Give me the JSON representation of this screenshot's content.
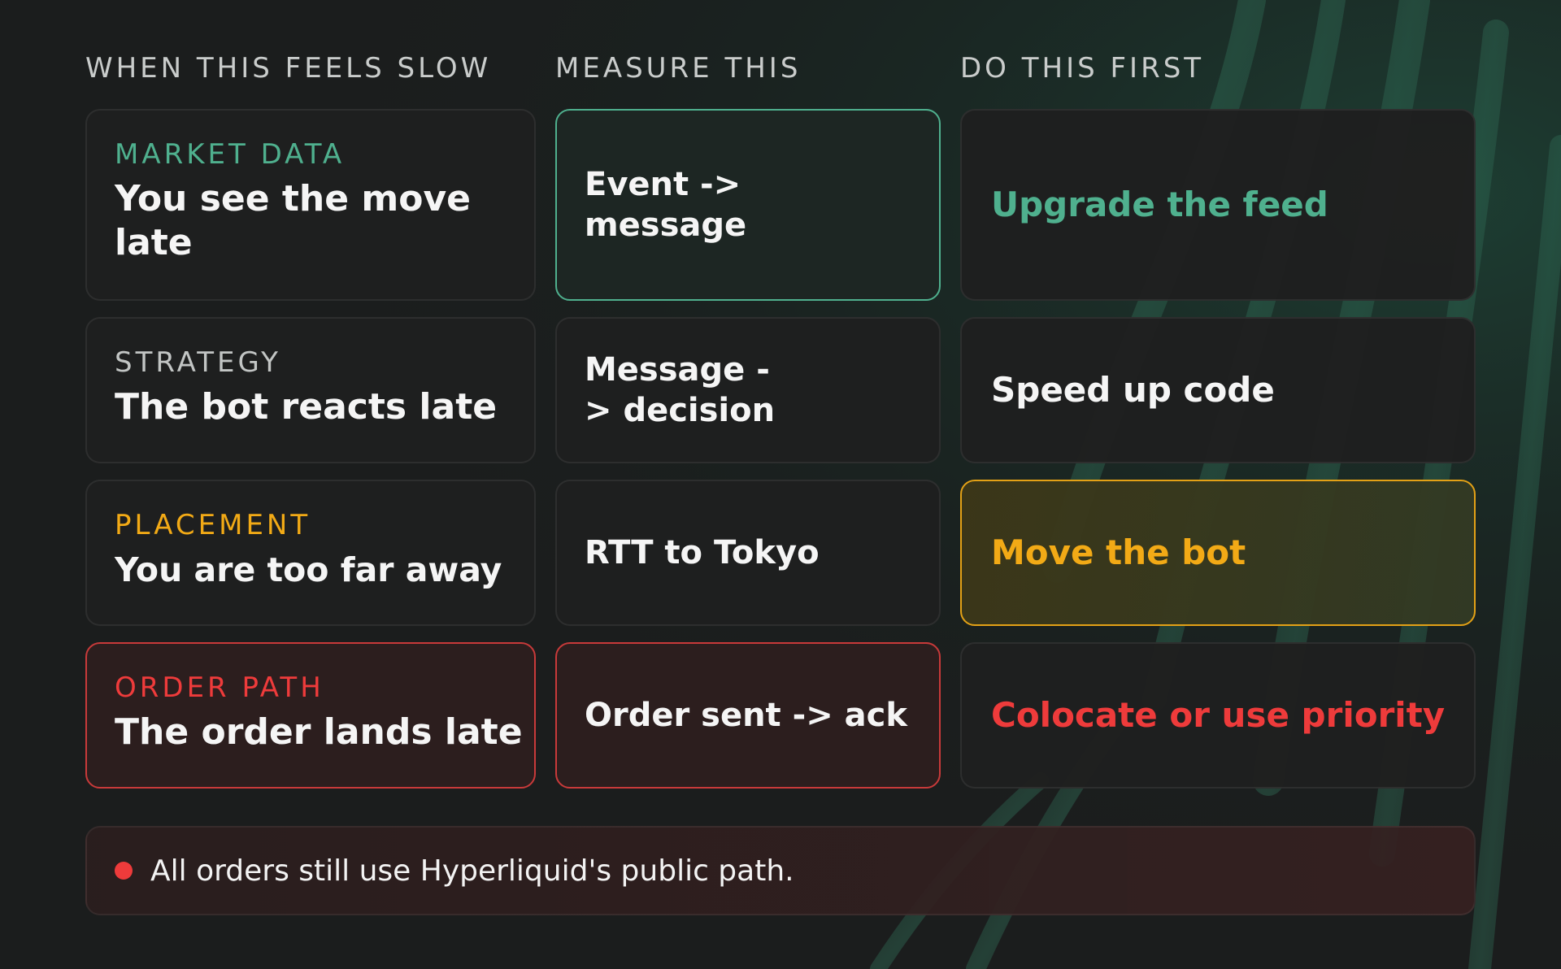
{
  "columns": {
    "symptom": "WHEN THIS FEELS SLOW",
    "measure": "MEASURE THIS",
    "action": "DO THIS FIRST"
  },
  "rows": [
    {
      "category": "MARKET DATA",
      "symptom": "You see the move late",
      "measure": "Event -> message",
      "action": "Upgrade the feed",
      "accent": "#4fb08e"
    },
    {
      "category": "STRATEGY",
      "symptom": "The bot reacts late",
      "measure": "Message -> decision",
      "action": "Speed up code",
      "accent": "#c2c5c4"
    },
    {
      "category": "PLACEMENT",
      "symptom": "You are too far away",
      "measure": "RTT to Tokyo",
      "action": "Move the bot",
      "accent": "#f2aa16"
    },
    {
      "category": "ORDER PATH",
      "symptom": "The order lands late",
      "measure": "Order sent -> ack",
      "action": "Colocate or use priority",
      "accent": "#ee3b3b"
    }
  ],
  "notice": {
    "text": "All orders still use Hyperliquid's public path.",
    "dot_color": "#ee3b3b"
  },
  "background": {
    "base": "#1b1d1d",
    "stripe_color": "#2f6b55"
  }
}
